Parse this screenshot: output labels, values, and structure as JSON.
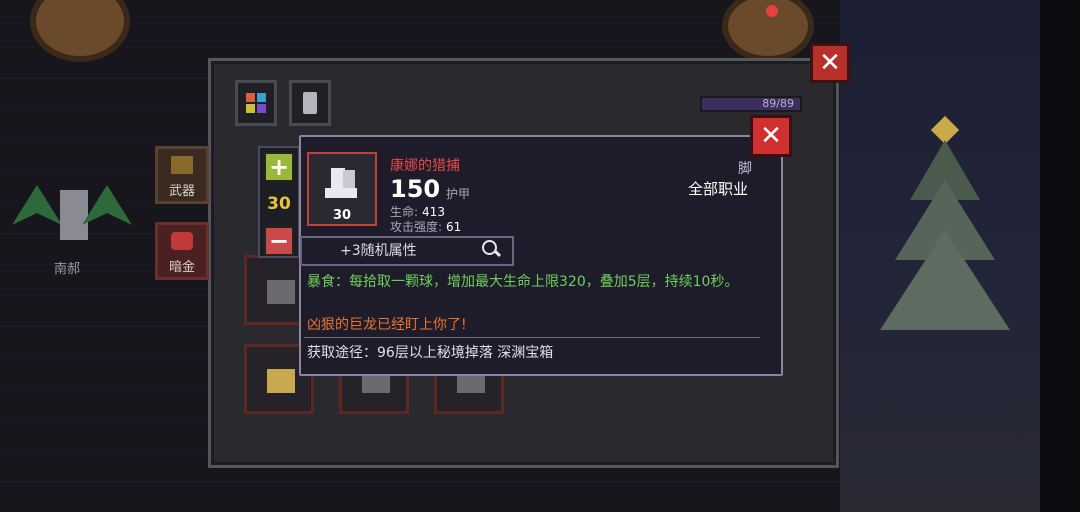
{
  "background": {
    "npc_name": "南郝"
  },
  "panel": {
    "energy_text": "89/89",
    "left_tabs": [
      {
        "label": "武器"
      },
      {
        "label": "暗金"
      }
    ],
    "quantity": "30"
  },
  "tooltip": {
    "item_name": "康娜的猎捕",
    "item_count": "30",
    "armor_value": "150",
    "armor_label": "护甲",
    "stats": [
      {
        "label": "生命:",
        "value": "413"
      },
      {
        "label": "攻击强度:",
        "value": "61"
      }
    ],
    "slot_type": "脚",
    "job_req": "全部职业",
    "random_attr": "+3随机属性",
    "effect_text": "暴食：每拾取一颗球，增加最大生命上限320，叠加5层，持续10秒。",
    "warning_text": "凶狠的巨龙已经盯上你了!",
    "source_text": "获取途径：96层以上秘境掉落 深渊宝箱"
  },
  "colors": {
    "item_name": "#e84848",
    "effect": "#6ed05a",
    "warning": "#e8742e",
    "quantity": "#e8c43a",
    "close": "#d03030"
  },
  "icons": [
    "close-icon",
    "inventory-grid-icon",
    "scroll-icon",
    "plus-icon",
    "minus-icon",
    "boots-icon",
    "magnifier-icon"
  ]
}
